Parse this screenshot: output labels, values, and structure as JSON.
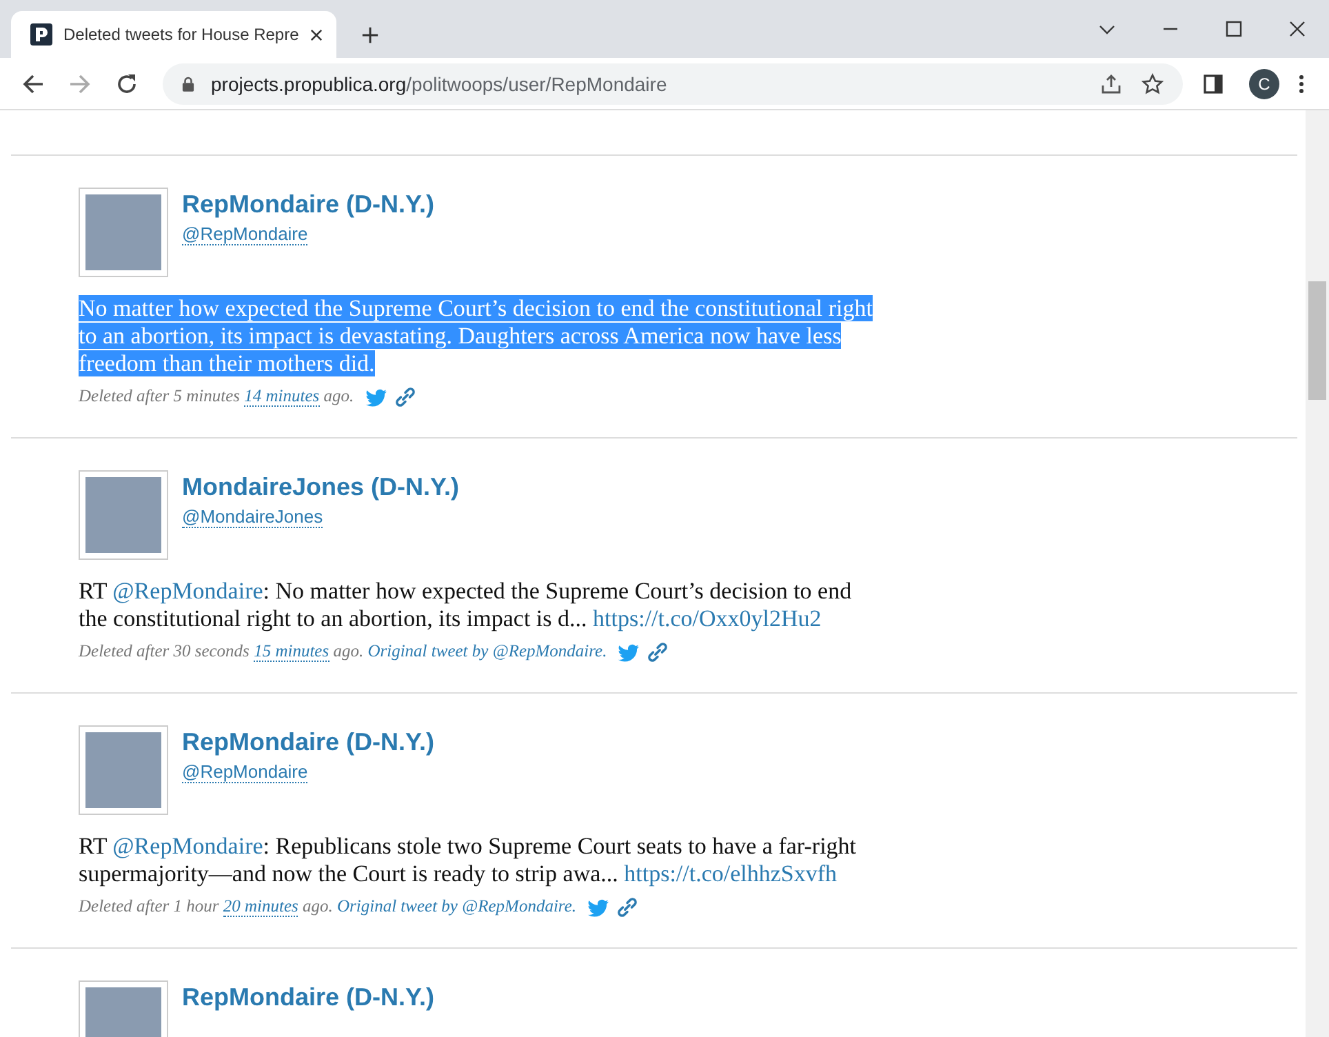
{
  "browser": {
    "tab_title": "Deleted tweets for House Repre",
    "url_host": "projects.propublica.org",
    "url_path": "/politwoops/user/RepMondaire",
    "profile_initial": "C"
  },
  "tweets": [
    {
      "name": "RepMondaire (D-N.Y.)",
      "handle": "@RepMondaire",
      "selected": true,
      "text": [
        {
          "kind": "plain",
          "text": "No matter how expected the Supreme Court’s decision to end the constitutional right to an abortion, its impact is devastating. Daughters across America now have less freedom than their mothers did."
        }
      ],
      "meta": [
        {
          "kind": "plain",
          "text": "Deleted after 5 minutes"
        },
        {
          "kind": "time",
          "text": "14 minutes"
        },
        {
          "kind": "plain",
          "text": "ago."
        }
      ]
    },
    {
      "name": "MondaireJones (D-N.Y.)",
      "handle": "@MondaireJones",
      "selected": false,
      "text": [
        {
          "kind": "plain",
          "text": "RT"
        },
        {
          "kind": "mention",
          "text": "@RepMondaire"
        },
        {
          "kind": "plain",
          "text": ": No matter how expected the Supreme Court’s decision to end the constitutional right to an abortion, its impact is d..."
        },
        {
          "kind": "url",
          "text": "https://t.co/Oxx0yl2Hu2"
        }
      ],
      "meta": [
        {
          "kind": "plain",
          "text": "Deleted after 30 seconds"
        },
        {
          "kind": "time",
          "text": "15 minutes"
        },
        {
          "kind": "plain",
          "text": "ago."
        },
        {
          "kind": "original",
          "text": "Original tweet by @RepMondaire."
        }
      ]
    },
    {
      "name": "RepMondaire (D-N.Y.)",
      "handle": "@RepMondaire",
      "selected": false,
      "text": [
        {
          "kind": "plain",
          "text": "RT"
        },
        {
          "kind": "mention",
          "text": "@RepMondaire"
        },
        {
          "kind": "plain",
          "text": ": Republicans stole two Supreme Court seats to have a far-right supermajority—and now the Court is ready to strip awa..."
        },
        {
          "kind": "url",
          "text": "https://t.co/elhhzSxvfh"
        }
      ],
      "meta": [
        {
          "kind": "plain",
          "text": "Deleted after 1 hour"
        },
        {
          "kind": "time",
          "text": "20 minutes"
        },
        {
          "kind": "plain",
          "text": "ago."
        },
        {
          "kind": "original",
          "text": "Original tweet by @RepMondaire."
        }
      ]
    },
    {
      "name": "RepMondaire (D-N.Y.)"
    }
  ]
}
